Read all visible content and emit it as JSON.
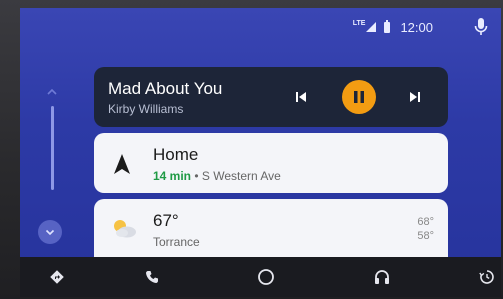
{
  "status_bar": {
    "network": "LTE",
    "time": "12:00",
    "icons": [
      "lte-signal-icon",
      "battery-icon",
      "microphone-icon"
    ]
  },
  "rail": {
    "icons": [
      "chevron-up-icon",
      "chevron-down-icon"
    ]
  },
  "media_card": {
    "title": "Mad About You",
    "artist": "Kirby Williams",
    "controls": [
      "skip-previous-icon",
      "pause-icon",
      "skip-next-icon"
    ],
    "accent": "#f39c12"
  },
  "navigation_card": {
    "destination": "Home",
    "eta": "14 min",
    "separator": "•",
    "route": "S Western Ave",
    "eta_color": "#1f9a45"
  },
  "weather_card": {
    "temperature": "67°",
    "location": "Torrance",
    "high": "68°",
    "low": "58°",
    "icon": "partly-cloudy-icon"
  },
  "bottom_nav": {
    "items": [
      "navigation-icon",
      "phone-icon",
      "home-circle-icon",
      "headphones-icon",
      "overview-icon"
    ]
  },
  "colors": {
    "screen_bg": "#2d3aa6",
    "media_card_bg": "#1d2538",
    "card_bg": "#f4f5f9",
    "navbar_bg": "#1a1b20"
  }
}
